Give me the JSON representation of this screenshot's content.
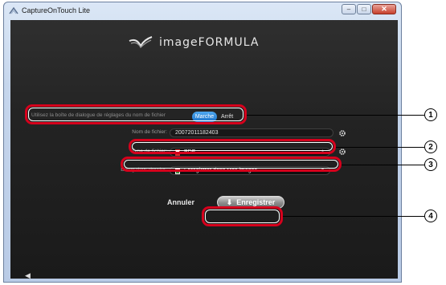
{
  "window": {
    "title": "CaptureOnTouch Lite",
    "buttons": {
      "minimize": "–",
      "maximize": "□",
      "close": "✕"
    }
  },
  "logo": {
    "text": "imageFORMULA"
  },
  "filename_dialog": {
    "label": "Utilisez la boîte de dialogue de réglages du nom de fichier",
    "on": "Marche",
    "off": "Arrêt"
  },
  "filename": {
    "label": "Nom de fichier:",
    "value": "20072011182403"
  },
  "filetype": {
    "label": "Type de fichier:",
    "value": "PDF"
  },
  "folder": {
    "label": "Enreg dans dossier:",
    "value": "Enregistrer dans Mes images"
  },
  "actions": {
    "cancel": "Annuler",
    "save": "Enregistrer"
  },
  "callouts": [
    "1",
    "2",
    "3",
    "4"
  ]
}
